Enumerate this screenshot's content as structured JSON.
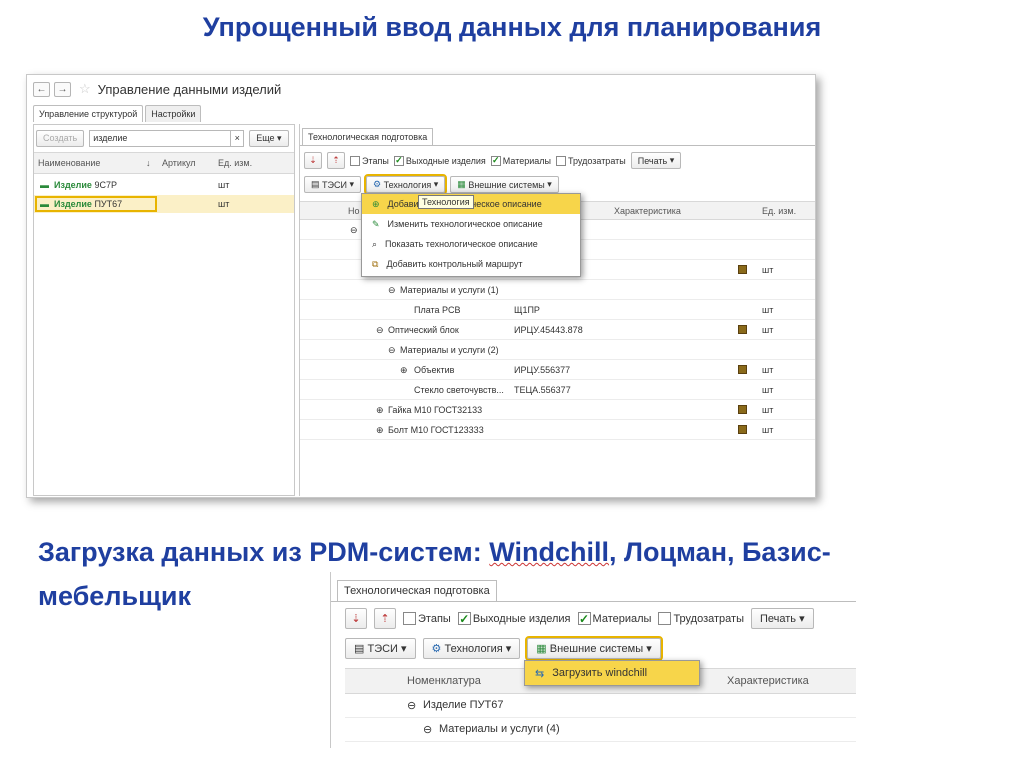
{
  "slide": {
    "title": "Упрощенный ввод данных для планирования",
    "section_title_part1": "Загрузка данных из PDM-систем: ",
    "section_title_underlined": "Windchill",
    "section_title_part2": ", Лоцман, Базис-мебельщик"
  },
  "window1": {
    "title": "Управление данными изделий",
    "tabs": [
      "Управление структурой",
      "Настройки"
    ],
    "left": {
      "create_label": "Создать",
      "search_value": "изделие",
      "clear_label": "×",
      "more_label": "Еще",
      "columns": [
        "Наименование",
        "Артикул",
        "Ед. изм."
      ],
      "rows": [
        {
          "prefix": "Изделие",
          "name": "9С7Р",
          "unit": "шт"
        },
        {
          "prefix": "Изделие",
          "name": "ПУТ67",
          "unit": "шт"
        }
      ]
    },
    "right": {
      "tab": "Технологическая подготовка",
      "checks": [
        {
          "label": "Этапы",
          "checked": false
        },
        {
          "label": "Выходные изделия",
          "checked": true
        },
        {
          "label": "Материалы",
          "checked": true
        },
        {
          "label": "Трудозатраты",
          "checked": false
        }
      ],
      "print_label": "Печать",
      "tesi_label": "ТЭСИ",
      "tech_label": "Технология",
      "external_label": "Внешние системы",
      "columns": {
        "nom": "Но",
        "char": "Характеристика",
        "unit": "Ед. изм."
      },
      "menu": [
        "Добавить технологическое описание",
        "Изменить технологическое описание",
        "Показать технологическое описание",
        "Добавить контрольный маршрут"
      ],
      "menu_first_visible": "Добави",
      "menu_first_tail": "ическое описание",
      "tooltip": "Технология",
      "rows": [
        {
          "name": "Материалы и услуги (1)",
          "code": "",
          "unit": ""
        },
        {
          "name": "Плата PCB",
          "code": "Щ1ПР",
          "unit": "шт"
        },
        {
          "name": "Оптический блок",
          "code": "ИРЦУ.45443.878",
          "unit": "шт"
        },
        {
          "name": "Материалы и услуги (2)",
          "code": "",
          "unit": ""
        },
        {
          "name": "Объектив",
          "code": "ИРЦУ.556377",
          "unit": "шт"
        },
        {
          "name": "Стекло светочувств...",
          "code": "ТЕЦА.556377",
          "unit": "шт"
        },
        {
          "name": "Гайка М10 ГОСТ32133",
          "code": "",
          "unit": "шт"
        },
        {
          "name": "Болт М10 ГОСТ123333",
          "code": "",
          "unit": "шт"
        }
      ],
      "row_unit_top": "шт"
    }
  },
  "window2": {
    "tab": "Технологическая подготовка",
    "checks": [
      {
        "label": "Этапы",
        "checked": false
      },
      {
        "label": "Выходные изделия",
        "checked": true
      },
      {
        "label": "Материалы",
        "checked": true
      },
      {
        "label": "Трудозатраты",
        "checked": false
      }
    ],
    "print_label": "Печать",
    "tesi_label": "ТЭСИ",
    "tech_label": "Технология",
    "external_label": "Внешние системы",
    "menu_item": "Загрузить windchill",
    "columns": {
      "nom": "Номенклатура",
      "char": "Характеристика"
    },
    "rows": [
      "Изделие ПУТ67",
      "Материалы и услуги (4)"
    ]
  },
  "colors": {
    "title": "#1f3fa0",
    "highlight": "#f7d54a",
    "green": "#2a8a3a"
  }
}
